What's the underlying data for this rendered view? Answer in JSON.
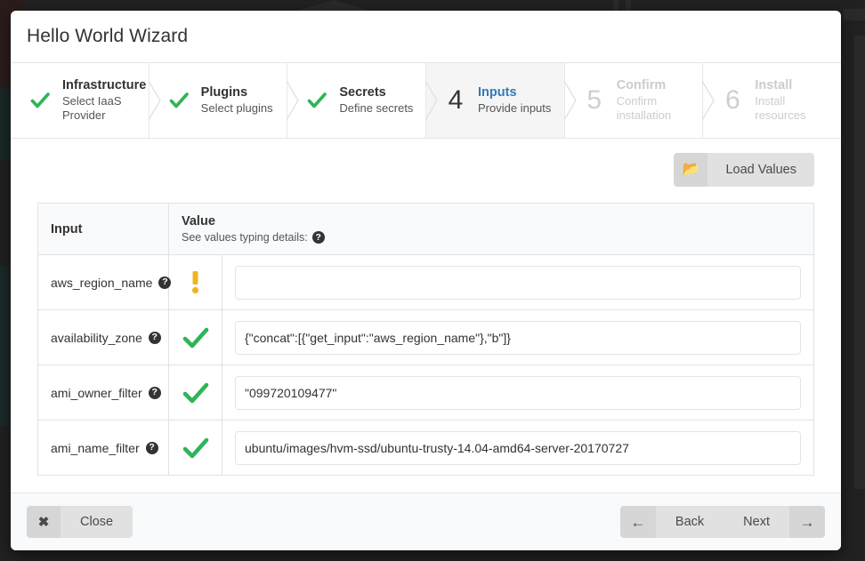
{
  "window": {
    "title": "Hello World Wizard"
  },
  "steps": [
    {
      "number": "1",
      "marker": "check",
      "name": "Infrastructure",
      "desc": "Select IaaS Provider",
      "state": "done"
    },
    {
      "number": "2",
      "marker": "check",
      "name": "Plugins",
      "desc": "Select plugins",
      "state": "done"
    },
    {
      "number": "3",
      "marker": "check",
      "name": "Secrets",
      "desc": "Define secrets",
      "state": "done"
    },
    {
      "number": "4",
      "marker": "number",
      "name": "Inputs",
      "desc": "Provide inputs",
      "state": "active"
    },
    {
      "number": "5",
      "marker": "number",
      "name": "Confirm",
      "desc": "Confirm installation",
      "state": "upcoming"
    },
    {
      "number": "6",
      "marker": "number",
      "name": "Install",
      "desc": "Install resources",
      "state": "upcoming"
    }
  ],
  "toolbar": {
    "load_values_label": "Load Values",
    "load_values_icon": "folder-open-icon"
  },
  "table": {
    "headers": {
      "input": "Input",
      "value": "Value",
      "value_sub": "See values typing details:",
      "value_sub_icon": "help-circle-icon"
    },
    "rows": [
      {
        "name": "aws_region_name",
        "help_icon": "help-circle-icon",
        "status": "warning",
        "value": "",
        "placeholder": ""
      },
      {
        "name": "availability_zone",
        "help_icon": "help-circle-icon",
        "status": "valid",
        "value": "{\"concat\":[{\"get_input\":\"aws_region_name\"},\"b\"]}",
        "placeholder": ""
      },
      {
        "name": "ami_owner_filter",
        "help_icon": "help-circle-icon",
        "status": "valid",
        "value": "\"099720109477\"",
        "placeholder": ""
      },
      {
        "name": "ami_name_filter",
        "help_icon": "help-circle-icon",
        "status": "valid",
        "value": "ubuntu/images/hvm-ssd/ubuntu-trusty-14.04-amd64-server-20170727",
        "placeholder": ""
      }
    ]
  },
  "footer": {
    "close_label": "Close",
    "close_icon": "close-x-icon",
    "back_label": "Back",
    "back_icon": "arrow-left-icon",
    "next_label": "Next",
    "next_icon": "arrow-right-icon"
  },
  "colors": {
    "accent_blue": "#337ab7",
    "success_green": "#2fb457",
    "warning_amber": "#f0b323",
    "header_bg": "#f9fafb",
    "active_step_bg": "#f5f5f5"
  }
}
